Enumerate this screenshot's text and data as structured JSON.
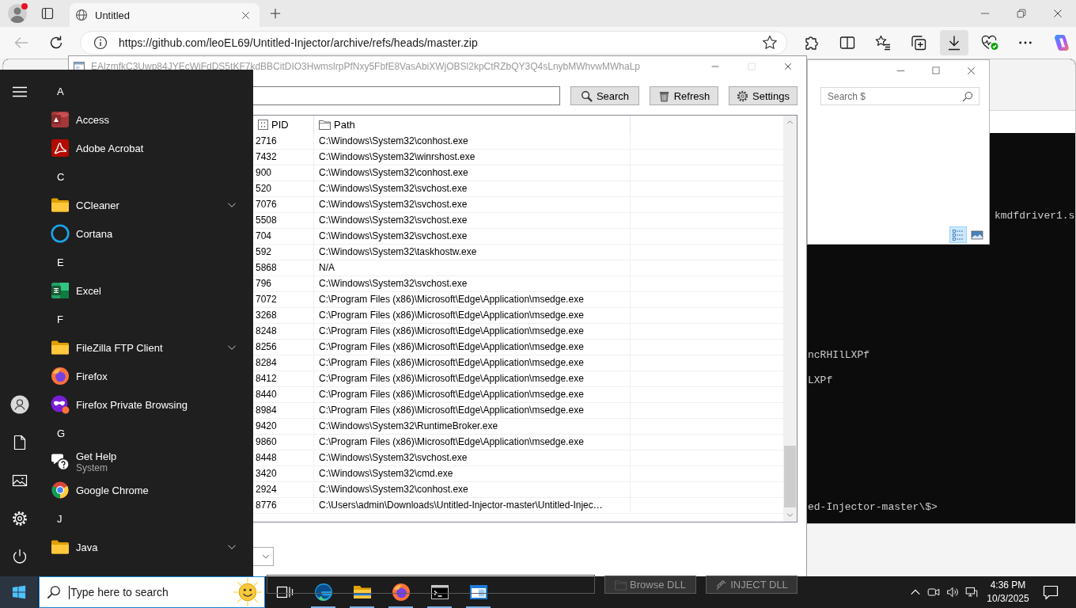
{
  "browser": {
    "tabs": [
      {
        "title": "Untitled",
        "selected": true
      }
    ],
    "nav": [
      {
        "kind": "back",
        "disabled": true
      },
      {
        "kind": "reload",
        "disabled": false
      }
    ],
    "address": "https://github.com/leoEL69/Untitled-Injector/archive/refs/heads/master.zip",
    "toolbar": [
      {
        "kind": "extensions",
        "selected": false
      },
      {
        "kind": "split_screen",
        "selected": false
      },
      {
        "kind": "favorites",
        "selected": false
      },
      {
        "kind": "collections",
        "selected": false
      },
      {
        "kind": "downloads",
        "selected": true
      },
      {
        "kind": "essentials",
        "selected": false
      },
      {
        "kind": "more",
        "selected": false
      },
      {
        "kind": "copilot",
        "selected": false
      }
    ]
  },
  "console_window": {
    "lines": [
      "kmdfdriver1.s",
      "ncRHIlLXPf",
      "LXPf",
      "ed-Injector-master\\$>"
    ]
  },
  "explorer_window": {
    "search": {
      "placeholder": "Search $"
    },
    "views": [
      {
        "kind": "details",
        "selected": true
      },
      {
        "kind": "large_icons",
        "selected": false
      }
    ]
  },
  "injector_window": {
    "title": "EAlzmfkC3Uwp84JYEcWiFdDS5tKF7kdBBCitDIO3HwmslrpPfNxy5FbfE8VasAbiXWjOBSl2kpCtRZbQY3Q4sLnybMWhvwMWhaLp",
    "active": false,
    "controls": [
      {
        "kind": "minimize",
        "disabled": false
      },
      {
        "kind": "maximize",
        "disabled": true
      },
      {
        "kind": "close",
        "disabled": false
      }
    ],
    "buttons": [
      {
        "kind": "search",
        "label": "Search"
      },
      {
        "kind": "refresh",
        "label": "Refresh"
      },
      {
        "kind": "settings",
        "label": "Settings"
      }
    ],
    "table": {
      "columns": [
        {
          "kind": "pid",
          "label": "PID"
        },
        {
          "kind": "path",
          "label": "Path"
        }
      ],
      "rows": [
        {
          "pid": "2716",
          "path": "C:\\Windows\\System32\\conhost.exe"
        },
        {
          "pid": "7432",
          "path": "C:\\Windows\\System32\\winrshost.exe"
        },
        {
          "pid": "900",
          "path": "C:\\Windows\\System32\\conhost.exe"
        },
        {
          "pid": "520",
          "path": "C:\\Windows\\System32\\svchost.exe"
        },
        {
          "pid": "7076",
          "path": "C:\\Windows\\System32\\svchost.exe"
        },
        {
          "pid": "5508",
          "path": "C:\\Windows\\System32\\svchost.exe"
        },
        {
          "pid": "704",
          "path": "C:\\Windows\\System32\\svchost.exe"
        },
        {
          "pid": "592",
          "path": "C:\\Windows\\System32\\taskhostw.exe"
        },
        {
          "pid": "5868",
          "path": "N/A"
        },
        {
          "pid": "796",
          "path": "C:\\Windows\\System32\\svchost.exe"
        },
        {
          "pid": "7072",
          "path": "C:\\Program Files (x86)\\Microsoft\\Edge\\Application\\msedge.exe"
        },
        {
          "pid": "3268",
          "path": "C:\\Program Files (x86)\\Microsoft\\Edge\\Application\\msedge.exe"
        },
        {
          "pid": "8248",
          "path": "C:\\Program Files (x86)\\Microsoft\\Edge\\Application\\msedge.exe"
        },
        {
          "pid": "8256",
          "path": "C:\\Program Files (x86)\\Microsoft\\Edge\\Application\\msedge.exe"
        },
        {
          "pid": "8284",
          "path": "C:\\Program Files (x86)\\Microsoft\\Edge\\Application\\msedge.exe"
        },
        {
          "pid": "8412",
          "path": "C:\\Program Files (x86)\\Microsoft\\Edge\\Application\\msedge.exe"
        },
        {
          "pid": "8440",
          "path": "C:\\Program Files (x86)\\Microsoft\\Edge\\Application\\msedge.exe"
        },
        {
          "pid": "8984",
          "path": "C:\\Program Files (x86)\\Microsoft\\Edge\\Application\\msedge.exe"
        },
        {
          "pid": "9420",
          "path": "C:\\Windows\\System32\\RuntimeBroker.exe"
        },
        {
          "pid": "9860",
          "path": "C:\\Program Files (x86)\\Microsoft\\Edge\\Application\\msedge.exe"
        },
        {
          "pid": "8448",
          "path": "C:\\Windows\\System32\\svchost.exe"
        },
        {
          "pid": "3420",
          "path": "C:\\Windows\\System32\\cmd.exe"
        },
        {
          "pid": "2924",
          "path": "C:\\Windows\\System32\\conhost.exe"
        },
        {
          "pid": "8776",
          "path": "C:\\Users\\admin\\Downloads\\Untitled-Injector-master\\Untitled-Injec…"
        }
      ]
    },
    "dll_buttons": [
      {
        "kind": "browse",
        "label": "Browse DLL"
      },
      {
        "kind": "inject",
        "label": "INJECT DLL"
      }
    ]
  },
  "start_menu": {
    "groups": [
      {
        "letter": "A",
        "apps": [
          {
            "name": "Access",
            "kind": "access"
          },
          {
            "name": "Adobe Acrobat",
            "kind": "acrobat"
          }
        ]
      },
      {
        "letter": "C",
        "apps": [
          {
            "name": "CCleaner",
            "kind": "folder"
          },
          {
            "name": "Cortana",
            "kind": "cortana"
          }
        ]
      },
      {
        "letter": "E",
        "apps": [
          {
            "name": "Excel",
            "kind": "excel"
          }
        ]
      },
      {
        "letter": "F",
        "apps": [
          {
            "name": "FileZilla FTP Client",
            "kind": "folder"
          },
          {
            "name": "Firefox",
            "kind": "firefox"
          },
          {
            "name": "Firefox Private Browsing",
            "kind": "firefox_private"
          }
        ]
      },
      {
        "letter": "G",
        "apps": [
          {
            "name": "Get Help",
            "subtitle": "System",
            "kind": "get_help"
          },
          {
            "name": "Google Chrome",
            "kind": "chrome"
          }
        ]
      },
      {
        "letter": "J",
        "apps": [
          {
            "name": "Java",
            "kind": "folder"
          }
        ]
      }
    ]
  },
  "taskbar": {
    "search": {
      "placeholder": "Type here to search"
    },
    "apps": [
      {
        "kind": "task_view",
        "running": false
      },
      {
        "kind": "edge",
        "running": true
      },
      {
        "kind": "explorer",
        "running": true
      },
      {
        "kind": "firefox",
        "running": true
      },
      {
        "kind": "terminal",
        "running": true
      },
      {
        "kind": "window_app",
        "running": true
      }
    ],
    "clock": {
      "time": "4:36 PM",
      "date": "10/3/2025"
    }
  }
}
